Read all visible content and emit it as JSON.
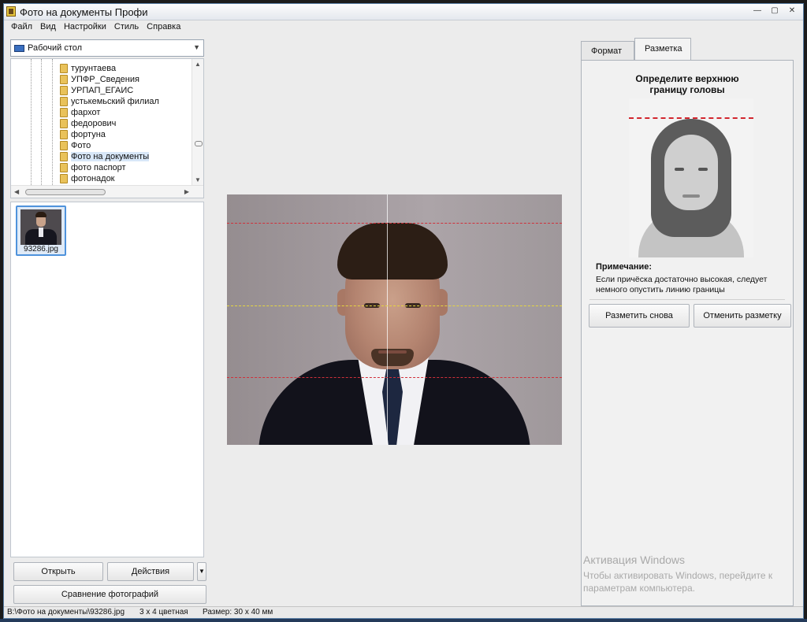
{
  "window": {
    "title": "Фото на документы Профи"
  },
  "window_buttons": {
    "minimize": "—",
    "restore": "▢",
    "close": "✕"
  },
  "menu": [
    "Файл",
    "Вид",
    "Настройки",
    "Стиль",
    "Справка"
  ],
  "left_panel": {
    "drive_combo": {
      "value": "Рабочий стол",
      "icon": "desktop-icon"
    },
    "tree_items": [
      "турунтаева",
      "УПФР_Сведения",
      "УРПАП_ЕГАИС",
      "устькемьский филиал",
      "фархот",
      "федорович",
      "фортуна",
      "Фото",
      "Фото на документы",
      "фото паспорт",
      "фотонадок"
    ],
    "selected_tree_item": "Фото на документы",
    "thumbnails": [
      {
        "filename": "93286.jpg"
      }
    ],
    "buttons": {
      "open": "Открыть",
      "actions": "Действия",
      "compare": "Сравнение фотографий"
    }
  },
  "tabs": {
    "format": "Формат",
    "markup": "Разметка",
    "active": "Разметка"
  },
  "markup_panel": {
    "title_line1": "Определите верхнюю",
    "title_line2": "границу головы",
    "note_label": "Примечание:",
    "note_line1": "Если причёска достаточно высокая, следует",
    "note_line2": "немного опустить линию границы",
    "remark_button": "Разметить снова",
    "cancel_button": "Отменить разметку"
  },
  "watermark": {
    "title": "Активация Windows",
    "line1": "Чтобы активировать Windows, перейдите к",
    "line2": "параметрам компьютера."
  },
  "status": {
    "path": "B:\\Фото на документы\\93286.jpg",
    "format": "3 x 4 цветная",
    "size": "Размер: 30 x 40 мм"
  },
  "colors": {
    "guide_red": "#d0303a",
    "guide_yellow": "#e6d640",
    "selection": "#4f93dc"
  }
}
